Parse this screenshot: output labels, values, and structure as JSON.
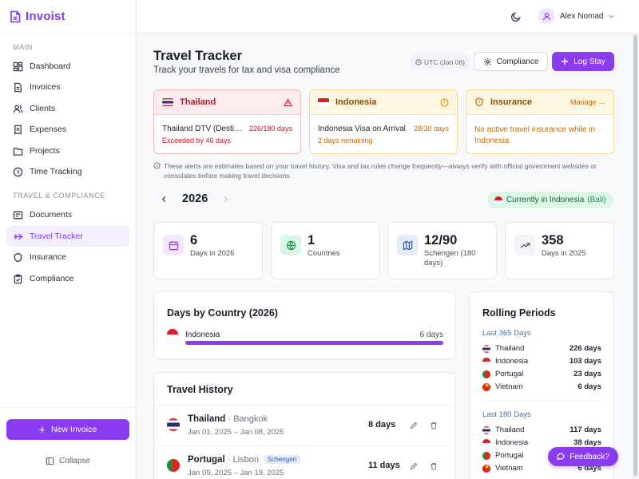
{
  "app": {
    "name": "Invoist"
  },
  "sidebar": {
    "main_label": "MAIN",
    "main_items": [
      {
        "label": "Dashboard",
        "icon": "dashboard-icon"
      },
      {
        "label": "Invoices",
        "icon": "invoice-icon"
      },
      {
        "label": "Clients",
        "icon": "users-icon"
      },
      {
        "label": "Expenses",
        "icon": "receipt-icon"
      },
      {
        "label": "Projects",
        "icon": "folder-icon"
      },
      {
        "label": "Time Tracking",
        "icon": "clock-icon"
      }
    ],
    "travel_label": "TRAVEL & COMPLIANCE",
    "travel_items": [
      {
        "label": "Documents",
        "icon": "id-card-icon"
      },
      {
        "label": "Travel Tracker",
        "icon": "plane-icon",
        "active": true
      },
      {
        "label": "Insurance",
        "icon": "shield-icon"
      },
      {
        "label": "Compliance",
        "icon": "clipboard-check-icon"
      }
    ],
    "new_invoice": "New Invoice",
    "collapse": "Collapse"
  },
  "topbar": {
    "user_name": "Alex Nomad"
  },
  "header": {
    "title": "Travel Tracker",
    "subtitle": "Track your travels for tax and visa compliance",
    "utc": "UTC (Jan 06)",
    "compliance_button": "Compliance",
    "log_stay_button": "Log Stay"
  },
  "alerts": {
    "thailand": {
      "title": "Thailand",
      "item": "Thailand DTV (Destination Thailand Visa)",
      "count": "226/180 days",
      "sub": "Exceeded by 46 days"
    },
    "indonesia": {
      "title": "Indonesia",
      "item": "Indonesia Visa on Arrival",
      "count": "28/30 days",
      "sub": "2 days remaining"
    },
    "insurance": {
      "title": "Insurance",
      "manage": "Manage →",
      "text": "No active travel insurance while in Indonesia"
    }
  },
  "disclaimer": "These alerts are estimates based on your travel history. Visa and tax rules change frequently—always verify with official government websites or consulates before making travel decisions.",
  "year": "2026",
  "current": {
    "label": "Currently in Indonesia",
    "loc": "(Bali)"
  },
  "stats": [
    {
      "value": "6",
      "label": "Days in 2026",
      "icon": "calendar-icon"
    },
    {
      "value": "1",
      "label": "Countries",
      "icon": "globe-icon"
    },
    {
      "value": "12/90",
      "label": "Schengen (180 days)",
      "icon": "map-icon"
    },
    {
      "value": "358",
      "label": "Days in 2025",
      "icon": "trending-up-icon"
    }
  ],
  "days_by_country": {
    "title": "Days by Country (2026)",
    "rows": [
      {
        "country": "Indonesia",
        "days": "6 days",
        "fraction": 1.0
      }
    ]
  },
  "travel_history": {
    "title": "Travel History",
    "rows": [
      {
        "country": "Thailand",
        "city": "· Bangkok",
        "dates": "Jan 01, 2025 – Jan 08, 2025",
        "duration": "8 days",
        "badge": ""
      },
      {
        "country": "Portugal",
        "city": "· Lisbon",
        "dates": "Jan 09, 2025 – Jan 19, 2025",
        "duration": "11 days",
        "badge": "Schengen"
      }
    ]
  },
  "rolling": {
    "title": "Rolling Periods",
    "last365": {
      "label": "Last 365 Days",
      "rows": [
        {
          "country": "Thailand",
          "days": "226 days"
        },
        {
          "country": "Indonesia",
          "days": "103 days"
        },
        {
          "country": "Portugal",
          "days": "23 days"
        },
        {
          "country": "Vietnam",
          "days": "6 days"
        }
      ]
    },
    "last180": {
      "label": "Last 180 Days",
      "rows": [
        {
          "country": "Thailand",
          "days": "117 days"
        },
        {
          "country": "Indonesia",
          "days": "38 days"
        },
        {
          "country": "Portugal",
          "days": ""
        },
        {
          "country": "Vietnam",
          "days": "6 days"
        }
      ]
    }
  },
  "feedback": "Feedback?",
  "colors": {
    "accent": "#8b3cf0",
    "danger": "#b4172b",
    "warning": "#c26a0a",
    "success": "#1b5e36"
  }
}
